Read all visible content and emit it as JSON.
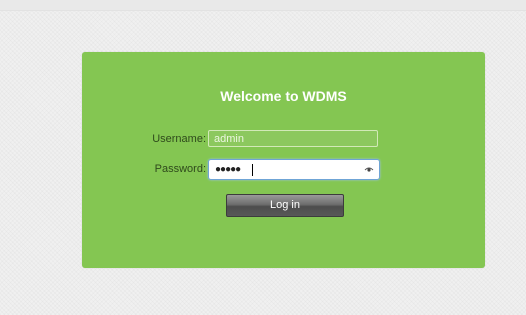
{
  "login": {
    "title": "Welcome to WDMS",
    "username_label": "Username:",
    "username_value": "admin",
    "password_label": "Password:",
    "password_mask": "●●●●●",
    "login_button_label": "Log in"
  },
  "colors": {
    "panel_bg": "#84c652",
    "page_bg": "#f0f0f0",
    "button_bg": "#5e5e5e",
    "focus_border": "#6fa4d6"
  },
  "icons": {
    "password_reveal": "eye-icon"
  }
}
